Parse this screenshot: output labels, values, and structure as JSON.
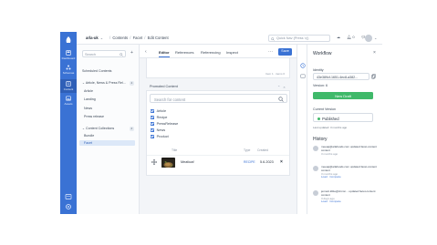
{
  "nav": {
    "items": [
      {
        "label": "Dashboard",
        "icon": "dashboard-icon"
      },
      {
        "label": "Schemas",
        "icon": "schemas-icon"
      },
      {
        "label": "Content",
        "icon": "content-icon"
      },
      {
        "label": "Assets",
        "icon": "assets-icon"
      }
    ],
    "active": "Content"
  },
  "topbar": {
    "app_name": "arla-uk",
    "breadcrumb": [
      "Contents",
      "Facet",
      "Edit Content"
    ],
    "search_placeholder": "Quick Nav (Press 'q')",
    "notifications_label": "0"
  },
  "schemas": {
    "search_placeholder": "Search",
    "items": [
      {
        "label": "Scheduled Contents",
        "type": "item"
      },
      {
        "label": "Article, News & Press Rel...",
        "type": "group",
        "count": "4"
      },
      {
        "label": "Article",
        "type": "sub"
      },
      {
        "label": "Landing",
        "type": "sub"
      },
      {
        "label": "News",
        "type": "sub"
      },
      {
        "label": "Press release",
        "type": "sub"
      },
      {
        "label": "Content Collections",
        "type": "group",
        "count": "2"
      },
      {
        "label": "Bundle",
        "type": "sub"
      },
      {
        "label": "Facet",
        "type": "sub",
        "active": true
      }
    ]
  },
  "editor": {
    "tabs": [
      "Editor",
      "References",
      "Referencing",
      "Inspect"
    ],
    "active_tab": "Editor",
    "more_label": "···",
    "save_label": "Save",
    "pager_text": "Item 1 · items 0",
    "field_label": "Promoted Content",
    "search_placeholder": "Search for content",
    "schema_filters": [
      "Article",
      "Recipe",
      "PressRelease",
      "News",
      "Product"
    ],
    "table": {
      "headers": [
        "Title",
        "Type",
        "Created"
      ],
      "rows": [
        {
          "title": "Meatloaf",
          "type": "RECIPE",
          "created": "5.6.2023"
        }
      ]
    }
  },
  "workflow": {
    "title": "Workflow",
    "identity_label": "Identity",
    "identity_value": "43e389cf-1651-4ec8-a382...",
    "version_label": "Version: 6",
    "new_draft_label": "New Draft",
    "current_version_label": "Current Version",
    "status": "Published",
    "status_color": "#40b96a",
    "last_updated": "Last updated: 3 months ago",
    "history_title": "History",
    "history": [
      {
        "text": "meeaq@arlafoods.com updated facet-content content",
        "time": "3 months ago",
        "links": ""
      },
      {
        "text": "meeaq@arlafoods.com updated facet-content content",
        "time": "3 months ago",
        "links": "Load · Compare"
      },
      {
        "text": "jennett.klitte@circon... updated facet-content content",
        "time": "3 days ago",
        "links": "Load · Compare"
      }
    ]
  },
  "colors": {
    "accent": "#3a72d4",
    "success": "#40b96a"
  }
}
